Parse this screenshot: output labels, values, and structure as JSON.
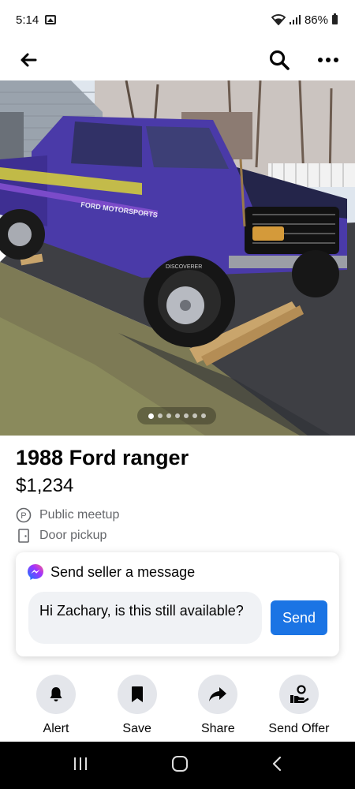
{
  "status_bar": {
    "time": "5:14",
    "battery": "86%",
    "icons": [
      "gallery-notification-icon",
      "wifi-icon",
      "signal-icon",
      "battery-icon"
    ]
  },
  "top_nav": {
    "back_icon": "arrow-left-icon",
    "search_icon": "search-icon",
    "more_icon": "more-horizontal-icon"
  },
  "photo": {
    "description_icon": "truck-photo",
    "decal_text": "FORD MOTORSPORTS",
    "tire_text": "DISCOVERER",
    "carousel_total": 7,
    "carousel_active": 1
  },
  "listing": {
    "title": "1988 Ford ranger",
    "price": "$1,234",
    "meetup_label": "Public meetup",
    "pickup_label": "Door pickup"
  },
  "message": {
    "header": "Send seller a message",
    "input_value": "Hi Zachary, is this still available?",
    "send_label": "Send"
  },
  "actions": [
    {
      "label": "Alert",
      "icon": "bell-icon"
    },
    {
      "label": "Save",
      "icon": "bookmark-icon"
    },
    {
      "label": "Share",
      "icon": "share-arrow-icon"
    },
    {
      "label": "Send Offer",
      "icon": "offer-hand-icon"
    }
  ],
  "colors": {
    "accent": "#1b74e4",
    "muted_text": "#65676b",
    "chip_bg": "#e4e6eb",
    "truck_purple": "#4a3aa8"
  }
}
